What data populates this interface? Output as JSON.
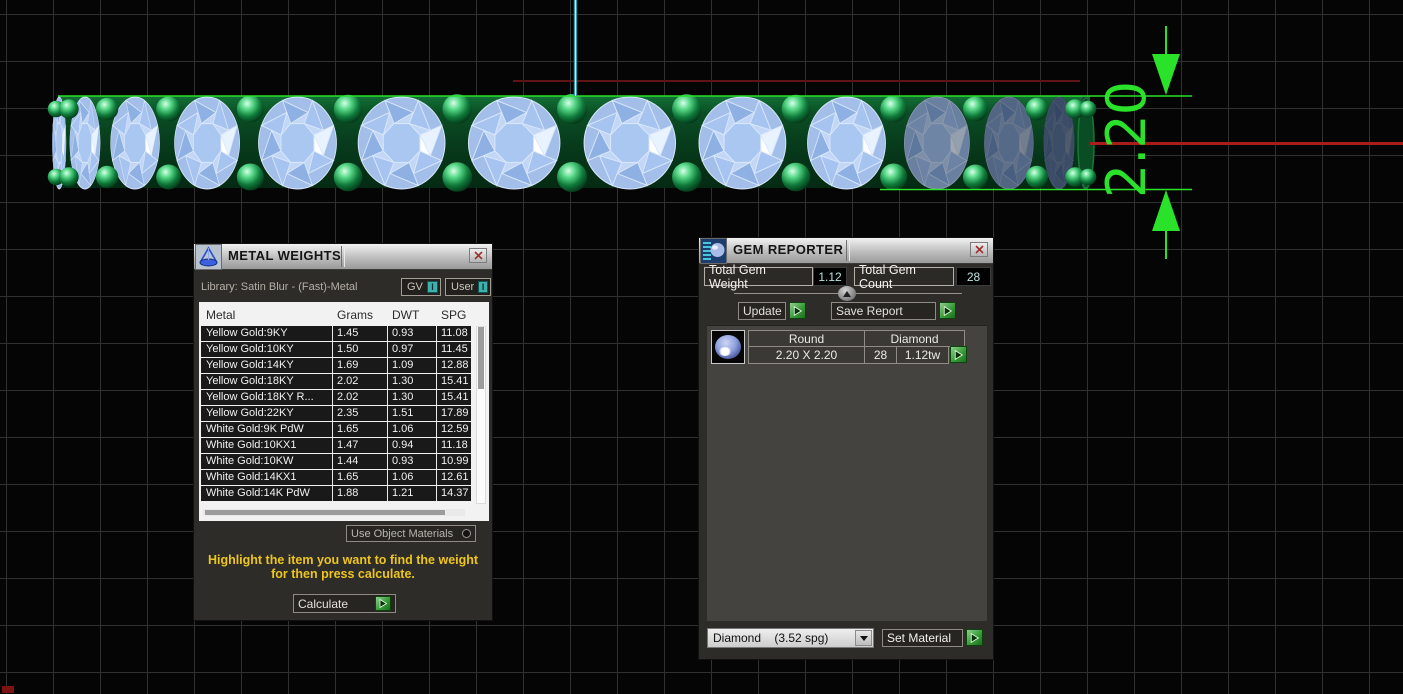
{
  "viewport": {
    "dimension_label": "2.20",
    "dimension_color": "#2ae22a",
    "x_axis_color": "#a81c1c",
    "construction_line_color": "#8fd8e4",
    "gem_color": "#9cbbee",
    "metal_color": "#0c5528",
    "grid_color": "#313131"
  },
  "metal_weights": {
    "title": "METAL WEIGHTS",
    "library_label": "Library: Satin Blur - (Fast)-Metal",
    "gv_toggle": "GV",
    "user_toggle": "User",
    "toggle_indicator": "I",
    "columns": [
      "Metal",
      "Grams",
      "DWT",
      "SPG"
    ],
    "rows": [
      {
        "metal": "Yellow Gold:9KY",
        "grams": "1.45",
        "dwt": "0.93",
        "spg": "11.08"
      },
      {
        "metal": "Yellow Gold:10KY",
        "grams": "1.50",
        "dwt": "0.97",
        "spg": "11.45"
      },
      {
        "metal": "Yellow Gold:14KY",
        "grams": "1.69",
        "dwt": "1.09",
        "spg": "12.88"
      },
      {
        "metal": "Yellow Gold:18KY",
        "grams": "2.02",
        "dwt": "1.30",
        "spg": "15.41"
      },
      {
        "metal": "Yellow Gold:18KY R...",
        "grams": "2.02",
        "dwt": "1.30",
        "spg": "15.41"
      },
      {
        "metal": "Yellow Gold:22KY",
        "grams": "2.35",
        "dwt": "1.51",
        "spg": "17.89"
      },
      {
        "metal": "White Gold:9K PdW",
        "grams": "1.65",
        "dwt": "1.06",
        "spg": "12.59"
      },
      {
        "metal": "White Gold:10KX1",
        "grams": "1.47",
        "dwt": "0.94",
        "spg": "11.18"
      },
      {
        "metal": "White Gold:10KW",
        "grams": "1.44",
        "dwt": "0.93",
        "spg": "10.99"
      },
      {
        "metal": "White Gold:14KX1",
        "grams": "1.65",
        "dwt": "1.06",
        "spg": "12.61"
      },
      {
        "metal": "White Gold:14K PdW",
        "grams": "1.88",
        "dwt": "1.21",
        "spg": "14.37"
      }
    ],
    "use_object_materials_label": "Use Object Materials",
    "hint_line1": "Highlight the item you want to find the weight",
    "hint_line2": "for then press calculate.",
    "calculate_label": "Calculate"
  },
  "gem_reporter": {
    "title": "GEM REPORTER",
    "total_gem_weight_label": "Total Gem Weight",
    "total_gem_weight_value": "1.12",
    "total_gem_count_label": "Total Gem Count",
    "total_gem_count_value": "28",
    "update_label": "Update",
    "save_report_label": "Save Report",
    "gem_row": {
      "shape": "Round",
      "type": "Diamond",
      "size": "2.20 X 2.20",
      "count": "28",
      "total_weight": "1.12tw"
    },
    "material_name": "Diamond",
    "material_spg": "(3.52 spg)",
    "set_material_label": "Set Material"
  }
}
